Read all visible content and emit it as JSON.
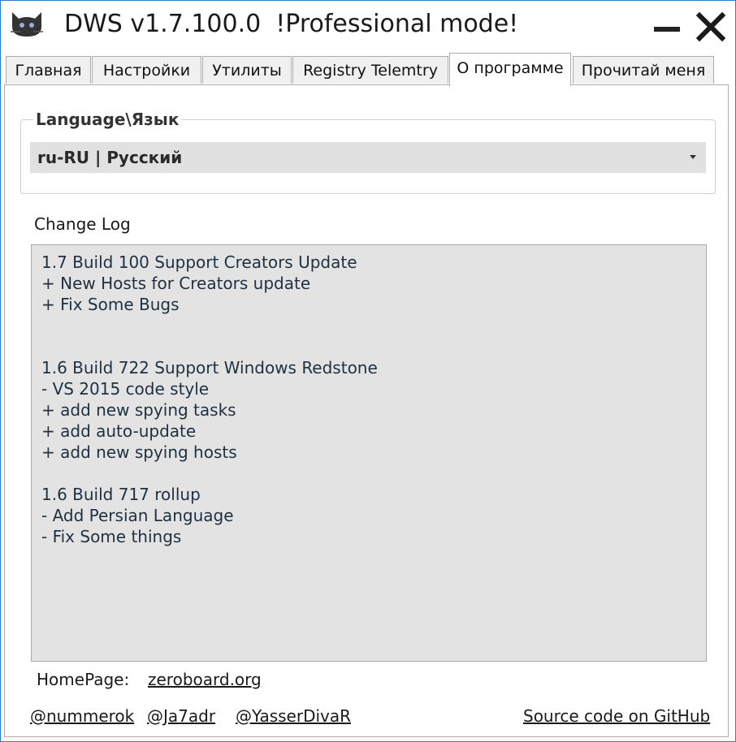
{
  "window": {
    "app_name": "DWS v1.7.100.0",
    "mode": "!Professional mode!"
  },
  "tabs": [
    {
      "label": "Главная"
    },
    {
      "label": "Настройки"
    },
    {
      "label": "Утилиты"
    },
    {
      "label": "Registry Telemtry"
    },
    {
      "label": "О программе"
    },
    {
      "label": "Прочитай меня"
    }
  ],
  "active_tab": "О программе",
  "language": {
    "group_label": "Language\\Язык",
    "selected": "ru-RU | Русский"
  },
  "changelog": {
    "label": "Change Log",
    "lines": [
      "1.7 Build 100 Support Creators Update",
      "+ New Hosts for Creators update",
      "+ Fix Some Bugs",
      "",
      "",
      "1.6 Build 722 Support Windows Redstone",
      "- VS 2015 code style",
      "+ add new spying tasks",
      "+ add auto-update",
      "+ add new spying hosts",
      "",
      "1.6 Build 717 rollup",
      "- Add Persian Language",
      "- Fix Some things"
    ]
  },
  "footer": {
    "homepage_label": "HomePage:",
    "homepage_link": "zeroboard.org",
    "author_links": [
      "@nummerok",
      "@Ja7adr",
      "@YasserDivaR"
    ],
    "source_link": "Source code on GitHub"
  },
  "icons": {
    "app": "cat-logo-icon",
    "minimize": "minimize-icon",
    "close": "close-icon",
    "dropdown": "chevron-down-icon"
  },
  "colors": {
    "window_border": "#2b7bd0",
    "changelog_bg": "#e3e3e3",
    "select_bg": "#e1e1e1",
    "changelog_text": "#1f3040"
  }
}
